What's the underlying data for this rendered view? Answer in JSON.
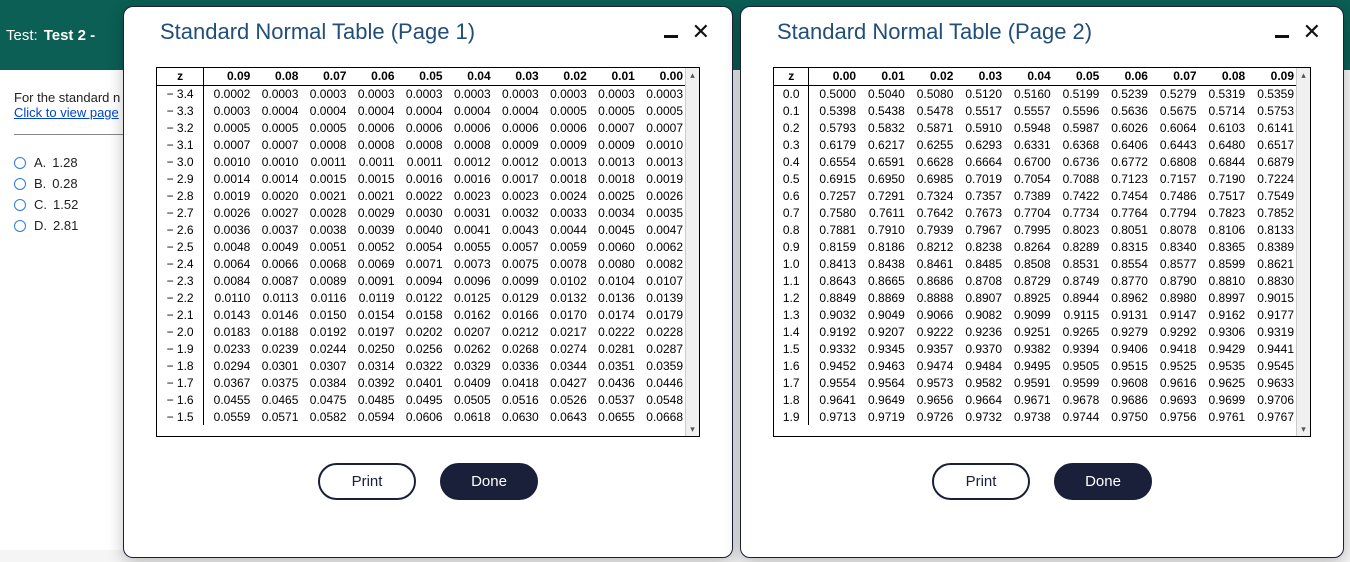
{
  "header": {
    "label": "Test:",
    "title": "Test 2 -"
  },
  "question": {
    "line1": "For the standard n",
    "link": "Click to view page",
    "choices": [
      {
        "letter": "A.",
        "value": "1.28"
      },
      {
        "letter": "B.",
        "value": "0.28"
      },
      {
        "letter": "C.",
        "value": "1.52"
      },
      {
        "letter": "D.",
        "value": "2.81"
      }
    ]
  },
  "buttons": {
    "print": "Print",
    "done": "Done"
  },
  "dialog1": {
    "title": "Standard Normal Table (Page 1)",
    "z_header": "z",
    "cols": [
      "0.09",
      "0.08",
      "0.07",
      "0.06",
      "0.05",
      "0.04",
      "0.03",
      "0.02",
      "0.01",
      "0.00"
    ],
    "rows": [
      {
        "z": "− 3.4",
        "v": [
          "0.0002",
          "0.0003",
          "0.0003",
          "0.0003",
          "0.0003",
          "0.0003",
          "0.0003",
          "0.0003",
          "0.0003",
          "0.0003"
        ]
      },
      {
        "z": "− 3.3",
        "v": [
          "0.0003",
          "0.0004",
          "0.0004",
          "0.0004",
          "0.0004",
          "0.0004",
          "0.0004",
          "0.0005",
          "0.0005",
          "0.0005"
        ]
      },
      {
        "z": "− 3.2",
        "v": [
          "0.0005",
          "0.0005",
          "0.0005",
          "0.0006",
          "0.0006",
          "0.0006",
          "0.0006",
          "0.0006",
          "0.0007",
          "0.0007"
        ]
      },
      {
        "z": "− 3.1",
        "v": [
          "0.0007",
          "0.0007",
          "0.0008",
          "0.0008",
          "0.0008",
          "0.0008",
          "0.0009",
          "0.0009",
          "0.0009",
          "0.0010"
        ]
      },
      {
        "z": "− 3.0",
        "v": [
          "0.0010",
          "0.0010",
          "0.0011",
          "0.0011",
          "0.0011",
          "0.0012",
          "0.0012",
          "0.0013",
          "0.0013",
          "0.0013"
        ]
      },
      {
        "z": "− 2.9",
        "v": [
          "0.0014",
          "0.0014",
          "0.0015",
          "0.0015",
          "0.0016",
          "0.0016",
          "0.0017",
          "0.0018",
          "0.0018",
          "0.0019"
        ]
      },
      {
        "z": "− 2.8",
        "v": [
          "0.0019",
          "0.0020",
          "0.0021",
          "0.0021",
          "0.0022",
          "0.0023",
          "0.0023",
          "0.0024",
          "0.0025",
          "0.0026"
        ]
      },
      {
        "z": "− 2.7",
        "v": [
          "0.0026",
          "0.0027",
          "0.0028",
          "0.0029",
          "0.0030",
          "0.0031",
          "0.0032",
          "0.0033",
          "0.0034",
          "0.0035"
        ]
      },
      {
        "z": "− 2.6",
        "v": [
          "0.0036",
          "0.0037",
          "0.0038",
          "0.0039",
          "0.0040",
          "0.0041",
          "0.0043",
          "0.0044",
          "0.0045",
          "0.0047"
        ]
      },
      {
        "z": "− 2.5",
        "v": [
          "0.0048",
          "0.0049",
          "0.0051",
          "0.0052",
          "0.0054",
          "0.0055",
          "0.0057",
          "0.0059",
          "0.0060",
          "0.0062"
        ]
      },
      {
        "z": "− 2.4",
        "v": [
          "0.0064",
          "0.0066",
          "0.0068",
          "0.0069",
          "0.0071",
          "0.0073",
          "0.0075",
          "0.0078",
          "0.0080",
          "0.0082"
        ]
      },
      {
        "z": "− 2.3",
        "v": [
          "0.0084",
          "0.0087",
          "0.0089",
          "0.0091",
          "0.0094",
          "0.0096",
          "0.0099",
          "0.0102",
          "0.0104",
          "0.0107"
        ]
      },
      {
        "z": "− 2.2",
        "v": [
          "0.0110",
          "0.0113",
          "0.0116",
          "0.0119",
          "0.0122",
          "0.0125",
          "0.0129",
          "0.0132",
          "0.0136",
          "0.0139"
        ]
      },
      {
        "z": "− 2.1",
        "v": [
          "0.0143",
          "0.0146",
          "0.0150",
          "0.0154",
          "0.0158",
          "0.0162",
          "0.0166",
          "0.0170",
          "0.0174",
          "0.0179"
        ]
      },
      {
        "z": "− 2.0",
        "v": [
          "0.0183",
          "0.0188",
          "0.0192",
          "0.0197",
          "0.0202",
          "0.0207",
          "0.0212",
          "0.0217",
          "0.0222",
          "0.0228"
        ]
      },
      {
        "z": "− 1.9",
        "v": [
          "0.0233",
          "0.0239",
          "0.0244",
          "0.0250",
          "0.0256",
          "0.0262",
          "0.0268",
          "0.0274",
          "0.0281",
          "0.0287"
        ]
      },
      {
        "z": "− 1.8",
        "v": [
          "0.0294",
          "0.0301",
          "0.0307",
          "0.0314",
          "0.0322",
          "0.0329",
          "0.0336",
          "0.0344",
          "0.0351",
          "0.0359"
        ]
      },
      {
        "z": "− 1.7",
        "v": [
          "0.0367",
          "0.0375",
          "0.0384",
          "0.0392",
          "0.0401",
          "0.0409",
          "0.0418",
          "0.0427",
          "0.0436",
          "0.0446"
        ]
      },
      {
        "z": "− 1.6",
        "v": [
          "0.0455",
          "0.0465",
          "0.0475",
          "0.0485",
          "0.0495",
          "0.0505",
          "0.0516",
          "0.0526",
          "0.0537",
          "0.0548"
        ]
      },
      {
        "z": "− 1.5",
        "v": [
          "0.0559",
          "0.0571",
          "0.0582",
          "0.0594",
          "0.0606",
          "0.0618",
          "0.0630",
          "0.0643",
          "0.0655",
          "0.0668"
        ]
      }
    ]
  },
  "dialog2": {
    "title": "Standard Normal Table (Page 2)",
    "z_header": "z",
    "cols": [
      "0.00",
      "0.01",
      "0.02",
      "0.03",
      "0.04",
      "0.05",
      "0.06",
      "0.07",
      "0.08",
      "0.09"
    ],
    "rows": [
      {
        "z": "0.0",
        "v": [
          "0.5000",
          "0.5040",
          "0.5080",
          "0.5120",
          "0.5160",
          "0.5199",
          "0.5239",
          "0.5279",
          "0.5319",
          "0.5359"
        ]
      },
      {
        "z": "0.1",
        "v": [
          "0.5398",
          "0.5438",
          "0.5478",
          "0.5517",
          "0.5557",
          "0.5596",
          "0.5636",
          "0.5675",
          "0.5714",
          "0.5753"
        ]
      },
      {
        "z": "0.2",
        "v": [
          "0.5793",
          "0.5832",
          "0.5871",
          "0.5910",
          "0.5948",
          "0.5987",
          "0.6026",
          "0.6064",
          "0.6103",
          "0.6141"
        ]
      },
      {
        "z": "0.3",
        "v": [
          "0.6179",
          "0.6217",
          "0.6255",
          "0.6293",
          "0.6331",
          "0.6368",
          "0.6406",
          "0.6443",
          "0.6480",
          "0.6517"
        ]
      },
      {
        "z": "0.4",
        "v": [
          "0.6554",
          "0.6591",
          "0.6628",
          "0.6664",
          "0.6700",
          "0.6736",
          "0.6772",
          "0.6808",
          "0.6844",
          "0.6879"
        ]
      },
      {
        "z": "0.5",
        "v": [
          "0.6915",
          "0.6950",
          "0.6985",
          "0.7019",
          "0.7054",
          "0.7088",
          "0.7123",
          "0.7157",
          "0.7190",
          "0.7224"
        ]
      },
      {
        "z": "0.6",
        "v": [
          "0.7257",
          "0.7291",
          "0.7324",
          "0.7357",
          "0.7389",
          "0.7422",
          "0.7454",
          "0.7486",
          "0.7517",
          "0.7549"
        ]
      },
      {
        "z": "0.7",
        "v": [
          "0.7580",
          "0.7611",
          "0.7642",
          "0.7673",
          "0.7704",
          "0.7734",
          "0.7764",
          "0.7794",
          "0.7823",
          "0.7852"
        ]
      },
      {
        "z": "0.8",
        "v": [
          "0.7881",
          "0.7910",
          "0.7939",
          "0.7967",
          "0.7995",
          "0.8023",
          "0.8051",
          "0.8078",
          "0.8106",
          "0.8133"
        ]
      },
      {
        "z": "0.9",
        "v": [
          "0.8159",
          "0.8186",
          "0.8212",
          "0.8238",
          "0.8264",
          "0.8289",
          "0.8315",
          "0.8340",
          "0.8365",
          "0.8389"
        ]
      },
      {
        "z": "1.0",
        "v": [
          "0.8413",
          "0.8438",
          "0.8461",
          "0.8485",
          "0.8508",
          "0.8531",
          "0.8554",
          "0.8577",
          "0.8599",
          "0.8621"
        ]
      },
      {
        "z": "1.1",
        "v": [
          "0.8643",
          "0.8665",
          "0.8686",
          "0.8708",
          "0.8729",
          "0.8749",
          "0.8770",
          "0.8790",
          "0.8810",
          "0.8830"
        ]
      },
      {
        "z": "1.2",
        "v": [
          "0.8849",
          "0.8869",
          "0.8888",
          "0.8907",
          "0.8925",
          "0.8944",
          "0.8962",
          "0.8980",
          "0.8997",
          "0.9015"
        ]
      },
      {
        "z": "1.3",
        "v": [
          "0.9032",
          "0.9049",
          "0.9066",
          "0.9082",
          "0.9099",
          "0.9115",
          "0.9131",
          "0.9147",
          "0.9162",
          "0.9177"
        ]
      },
      {
        "z": "1.4",
        "v": [
          "0.9192",
          "0.9207",
          "0.9222",
          "0.9236",
          "0.9251",
          "0.9265",
          "0.9279",
          "0.9292",
          "0.9306",
          "0.9319"
        ]
      },
      {
        "z": "1.5",
        "v": [
          "0.9332",
          "0.9345",
          "0.9357",
          "0.9370",
          "0.9382",
          "0.9394",
          "0.9406",
          "0.9418",
          "0.9429",
          "0.9441"
        ]
      },
      {
        "z": "1.6",
        "v": [
          "0.9452",
          "0.9463",
          "0.9474",
          "0.9484",
          "0.9495",
          "0.9505",
          "0.9515",
          "0.9525",
          "0.9535",
          "0.9545"
        ]
      },
      {
        "z": "1.7",
        "v": [
          "0.9554",
          "0.9564",
          "0.9573",
          "0.9582",
          "0.9591",
          "0.9599",
          "0.9608",
          "0.9616",
          "0.9625",
          "0.9633"
        ]
      },
      {
        "z": "1.8",
        "v": [
          "0.9641",
          "0.9649",
          "0.9656",
          "0.9664",
          "0.9671",
          "0.9678",
          "0.9686",
          "0.9693",
          "0.9699",
          "0.9706"
        ]
      },
      {
        "z": "1.9",
        "v": [
          "0.9713",
          "0.9719",
          "0.9726",
          "0.9732",
          "0.9738",
          "0.9744",
          "0.9750",
          "0.9756",
          "0.9761",
          "0.9767"
        ]
      }
    ]
  }
}
